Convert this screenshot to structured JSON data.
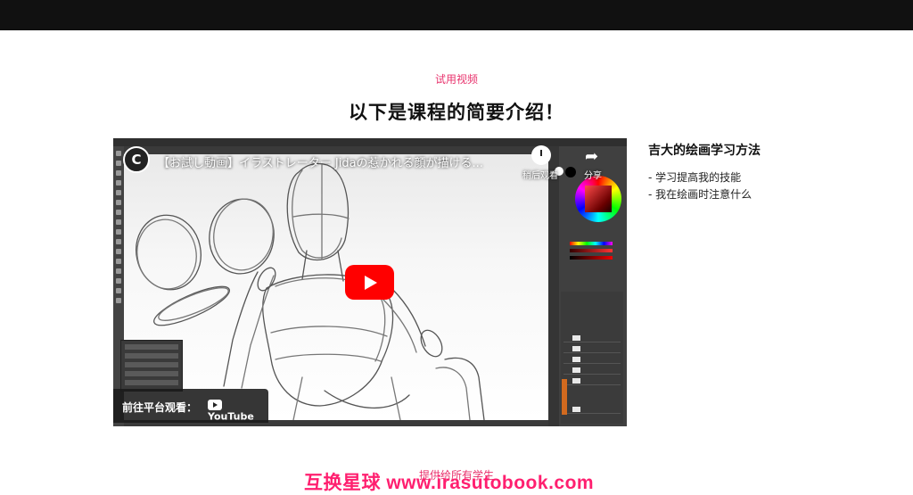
{
  "header": {
    "eyebrow": "试用视频",
    "title": "以下是课程的简要介绍！"
  },
  "video": {
    "channel_initial": "C",
    "title": "【お試し動画】イラストレーター Jidaの惹かれる顔が描ける...",
    "watch_later_label": "稍后观看",
    "share_label": "分享",
    "watch_on_label": "前往平台观看：",
    "platform_name": "YouTube"
  },
  "sidebar": {
    "title": "吉大的绘画学习方法",
    "items": [
      "- 学习提高我的技能",
      "- 我在绘画时注意什么"
    ]
  },
  "footer": {
    "text": "提供给所有学生"
  },
  "watermark": {
    "text": "互换星球 www.irasutobook.com"
  },
  "colors": {
    "accent": "#e8336d",
    "youtube_red": "#ff0000",
    "topbar": "#111111"
  }
}
